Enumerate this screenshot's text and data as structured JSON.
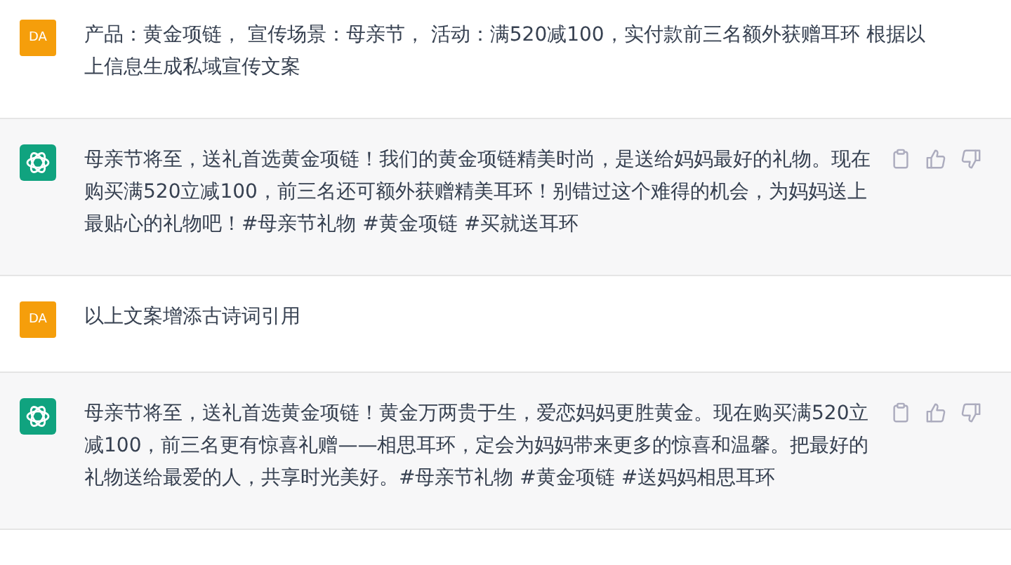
{
  "messages": [
    {
      "kind": "user",
      "avatar": "DA",
      "text": "产品：黄金项链， 宣传场景：母亲节， 活动：满520减100，实付款前三名额外获赠耳环  根据以上信息生成私域宣传文案"
    },
    {
      "kind": "assistant",
      "text": "母亲节将至，送礼首选黄金项链！我们的黄金项链精美时尚，是送给妈妈最好的礼物。现在购买满520立减100，前三名还可额外获赠精美耳环！别错过这个难得的机会，为妈妈送上最贴心的礼物吧！#母亲节礼物 #黄金项链 #买就送耳环"
    },
    {
      "kind": "user",
      "avatar": "DA",
      "text": "以上文案增添古诗词引用"
    },
    {
      "kind": "assistant",
      "text": "母亲节将至，送礼首选黄金项链！黄金万两贵于生，爱恋妈妈更胜黄金。现在购买满520立减100，前三名更有惊喜礼赠——相思耳环，定会为妈妈带来更多的惊喜和温馨。把最好的礼物送给最爱的人，共享时光美好。#母亲节礼物 #黄金项链 #送妈妈相思耳环"
    }
  ]
}
